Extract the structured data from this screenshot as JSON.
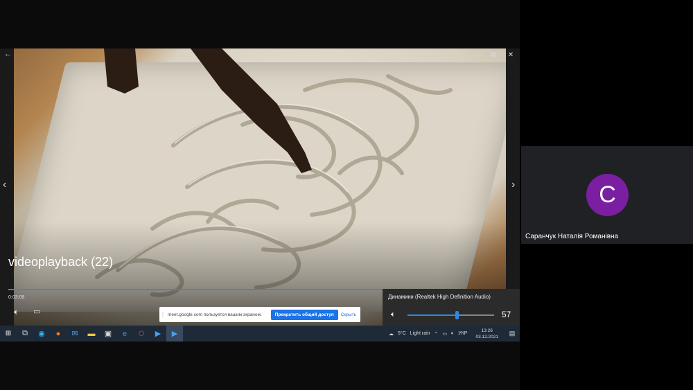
{
  "video": {
    "title": "videoplayback (22)",
    "time": "0:03:08",
    "progress_fraction": 0.75
  },
  "window_controls": {
    "back_icon": "back-arrow-icon",
    "minimize": "—",
    "restore": "⧉",
    "close": "✕"
  },
  "nav": {
    "prev": "‹",
    "next": "›"
  },
  "share_bar": {
    "message": "meet.google.com пользуется вашим экраном.",
    "stop_label": "Прекратить общий доступ",
    "hide_label": "Скрыть"
  },
  "volume_flyout": {
    "device": "Динамики (Realtek High Definition Audio)",
    "level": 57
  },
  "taskbar": {
    "weather_temp": "5°C",
    "weather_text": "Light rain",
    "language": "УКР",
    "time": "13:26",
    "date": "03.12.2021"
  },
  "participant": {
    "initial": "С",
    "name": "Саранчук Наталія Романівна",
    "avatar_color": "#7b1fa2"
  }
}
